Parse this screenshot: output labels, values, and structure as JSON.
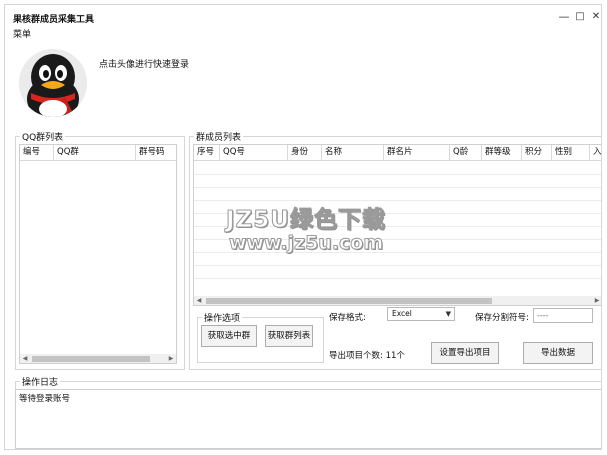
{
  "window": {
    "title": "果核群成员采集工具",
    "minimize_glyph": "—",
    "maximize_glyph": "□",
    "close_glyph": "✕"
  },
  "menu": {
    "label": "菜单"
  },
  "login": {
    "hint": "点击头像进行快速登录",
    "avatar_icon": "qq-penguin-icon"
  },
  "qq_groups": {
    "legend": "QQ群列表",
    "columns": [
      "编号",
      "QQ群",
      "群号码"
    ]
  },
  "members": {
    "legend": "群成员列表",
    "columns": [
      "序号",
      "QQ号",
      "身份",
      "名称",
      "群名片",
      "Q龄",
      "群等级",
      "积分",
      "性别",
      "入"
    ]
  },
  "operations": {
    "legend": "操作选项",
    "get_selected_label": "获取选中群",
    "get_groups_label": "获取群列表",
    "save_format_label": "保存格式:",
    "save_format_value": "Excel",
    "separator_label": "保存分割符号:",
    "separator_value": "----",
    "export_count_label": "导出项目个数: 11个",
    "set_export_label": "设置导出项目",
    "export_label": "导出数据"
  },
  "log": {
    "legend": "操作日志",
    "text": "等待登录账号"
  },
  "watermark": {
    "line1": "JZ5U绿色下载",
    "line2": "www.jz5u.com"
  }
}
